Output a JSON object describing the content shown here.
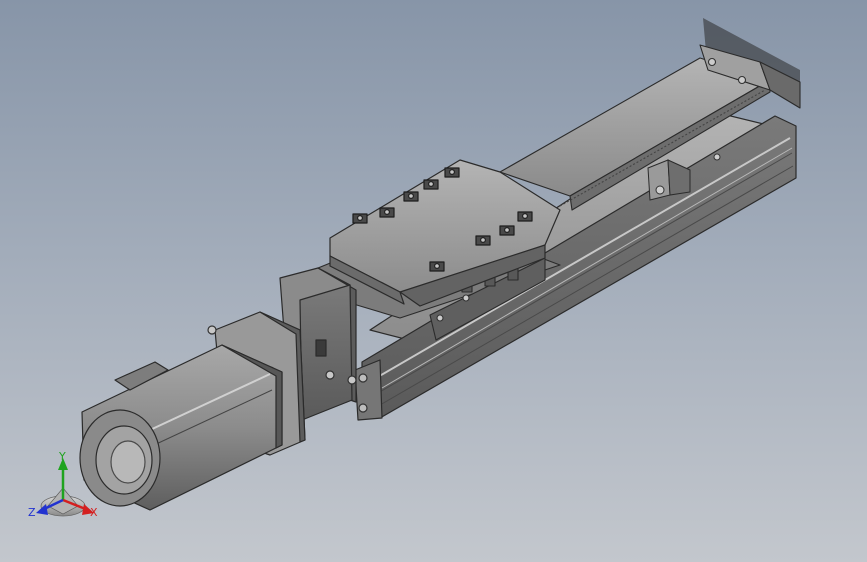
{
  "viewport": {
    "background_top": "#8795a8",
    "background_bottom": "#c3c7cd"
  },
  "model": {
    "parts": [
      "servo-motor",
      "motor-flange",
      "coupling-housing",
      "linear-rail-base",
      "carriage-slide",
      "top-cover",
      "limit-sensor",
      "end-cap"
    ],
    "body_color": "#8f8f8f",
    "dark_color": "#3d3d3d"
  },
  "triad": {
    "x_label": "X",
    "y_label": "Y",
    "z_label": "Z",
    "x_color": "#d42020",
    "y_color": "#1fa31f",
    "z_color": "#2233d0"
  }
}
